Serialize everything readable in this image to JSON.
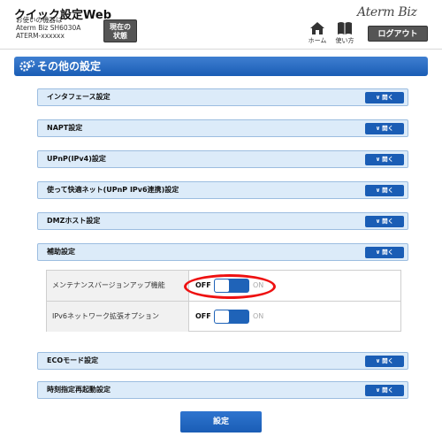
{
  "header": {
    "app_title": "クイック設定Web",
    "device_lines": [
      "お使いの機器は",
      "Aterm Biz SH6030A",
      "ATERM-xxxxxx"
    ],
    "status_button_lines": [
      "現在の",
      "状態"
    ],
    "home_label": "ホーム",
    "help_label": "使い方",
    "brand": "Aterm Biz",
    "logout_label": "ログアウト"
  },
  "section": {
    "title": "その他の設定"
  },
  "open_label": "開く",
  "accordions_top": [
    {
      "label": "インタフェース設定"
    },
    {
      "label": "NAPT設定"
    },
    {
      "label": "UPnP(IPv4)設定"
    },
    {
      "label": "使って快適ネット(UPnP IPv6連携)設定"
    },
    {
      "label": "DMZホスト設定"
    },
    {
      "label": "補助設定"
    }
  ],
  "sub_settings": [
    {
      "label": "メンテナンスバージョンアップ機能",
      "off": "OFF",
      "on": "ON",
      "state": "OFF"
    },
    {
      "label": "IPv6ネットワーク拡張オプション",
      "off": "OFF",
      "on": "ON",
      "state": "OFF"
    }
  ],
  "accordions_bottom": [
    {
      "label": "ECOモード設定"
    },
    {
      "label": "時刻指定再起動設定"
    }
  ],
  "submit_label": "設定",
  "colors": {
    "accent": "#1a5db5",
    "row_bg": "#dcebf9",
    "highlight": "#ee1111"
  }
}
